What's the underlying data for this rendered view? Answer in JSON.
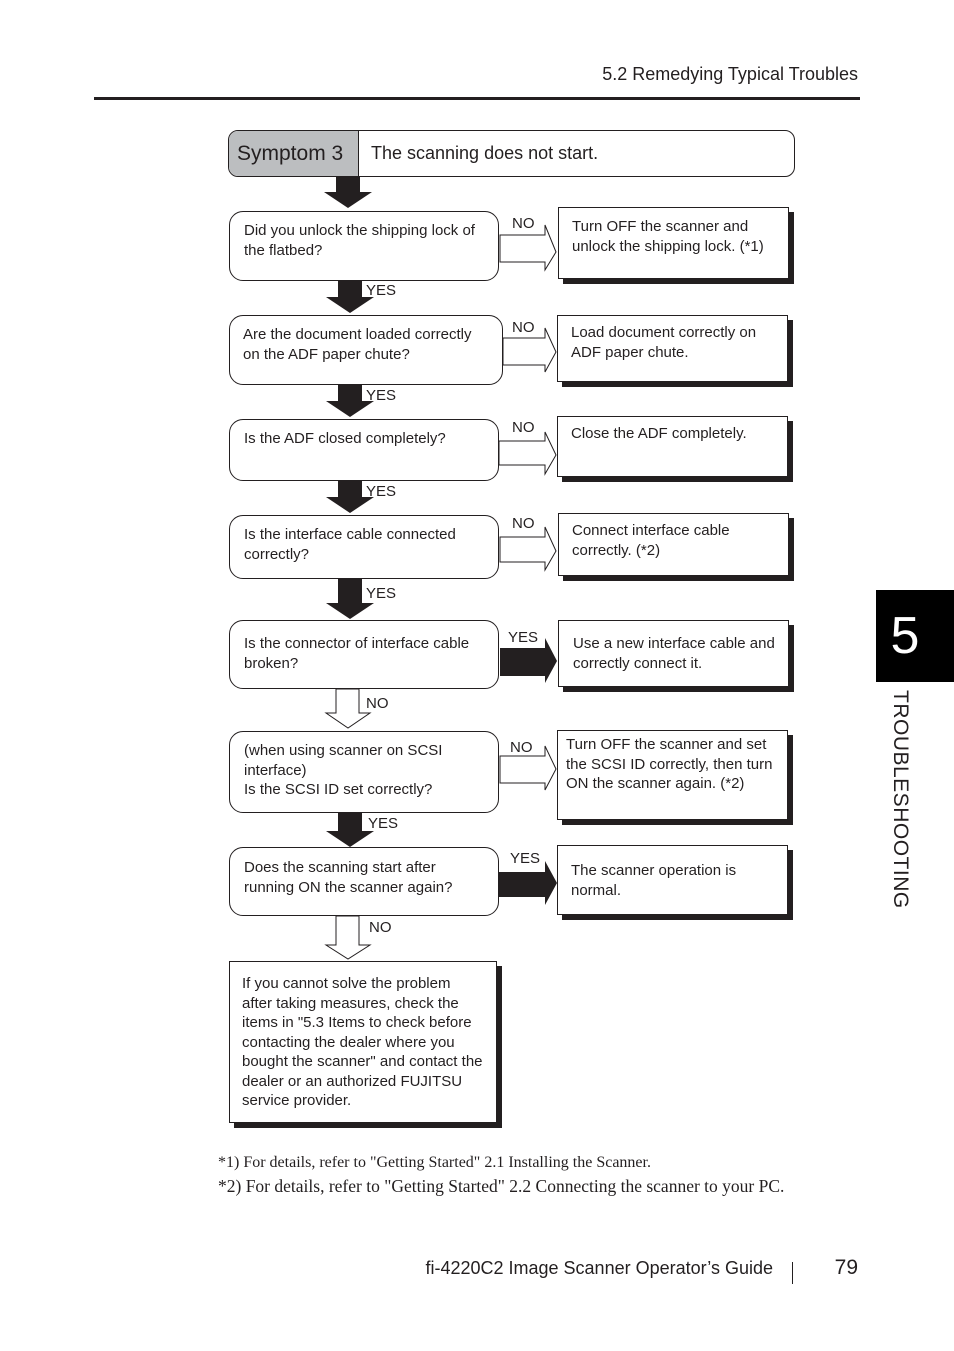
{
  "header": {
    "section": "5.2 Remedying Typical Troubles"
  },
  "symptom": {
    "label": "Symptom 3",
    "text": "The scanning does not start."
  },
  "steps": [
    {
      "question": "Did you unlock the shipping lock of the flatbed?",
      "branch_label": "NO",
      "action": "Turn OFF the scanner and unlock the shipping lock. (*1)",
      "next_label": "YES"
    },
    {
      "question": "Are the document loaded correctly on the ADF paper chute?",
      "branch_label": "NO",
      "action": "Load document correctly on ADF paper chute.",
      "next_label": "YES"
    },
    {
      "question": "Is the ADF closed completely?",
      "branch_label": "NO",
      "action": "Close the ADF completely.",
      "next_label": "YES"
    },
    {
      "question": "Is the interface cable connected correctly?",
      "branch_label": "NO",
      "action": "Connect interface cable correctly. (*2)",
      "next_label": "YES"
    },
    {
      "question": "Is the connector of interface cable broken?",
      "branch_label": "YES",
      "action": "Use a new interface cable and correctly connect it.",
      "next_label": "NO"
    },
    {
      "question": "(when using scanner on SCSI interface)\nIs the SCSI ID set correctly?",
      "branch_label": "NO",
      "action": "Turn OFF the scanner and set the SCSI ID correctly, then turn ON the scanner again. (*2)",
      "next_label": "YES"
    },
    {
      "question": "Does the scanning start after running ON the scanner again?",
      "branch_label": "YES",
      "action": "The scanner operation is normal.",
      "next_label": "NO"
    }
  ],
  "final_box": "If you cannot solve the problem after taking measures, check the items in \"5.3 Items to check before contacting the dealer where you bought the scanner\" and contact the dealer or an authorized FUJITSU service provider.",
  "footnotes": [
    "*1) For details, refer to \"Getting Started\" 2.1 Installing the Scanner.",
    "*2) For details, refer to \"Getting Started\" 2.2 Connecting the scanner to your PC."
  ],
  "footer": {
    "guide_title": "fi-4220C2 Image Scanner Operator’s Guide",
    "page_number": "79"
  },
  "chapter_tab": {
    "number": "5",
    "label": "TROUBLESHOOTING"
  }
}
